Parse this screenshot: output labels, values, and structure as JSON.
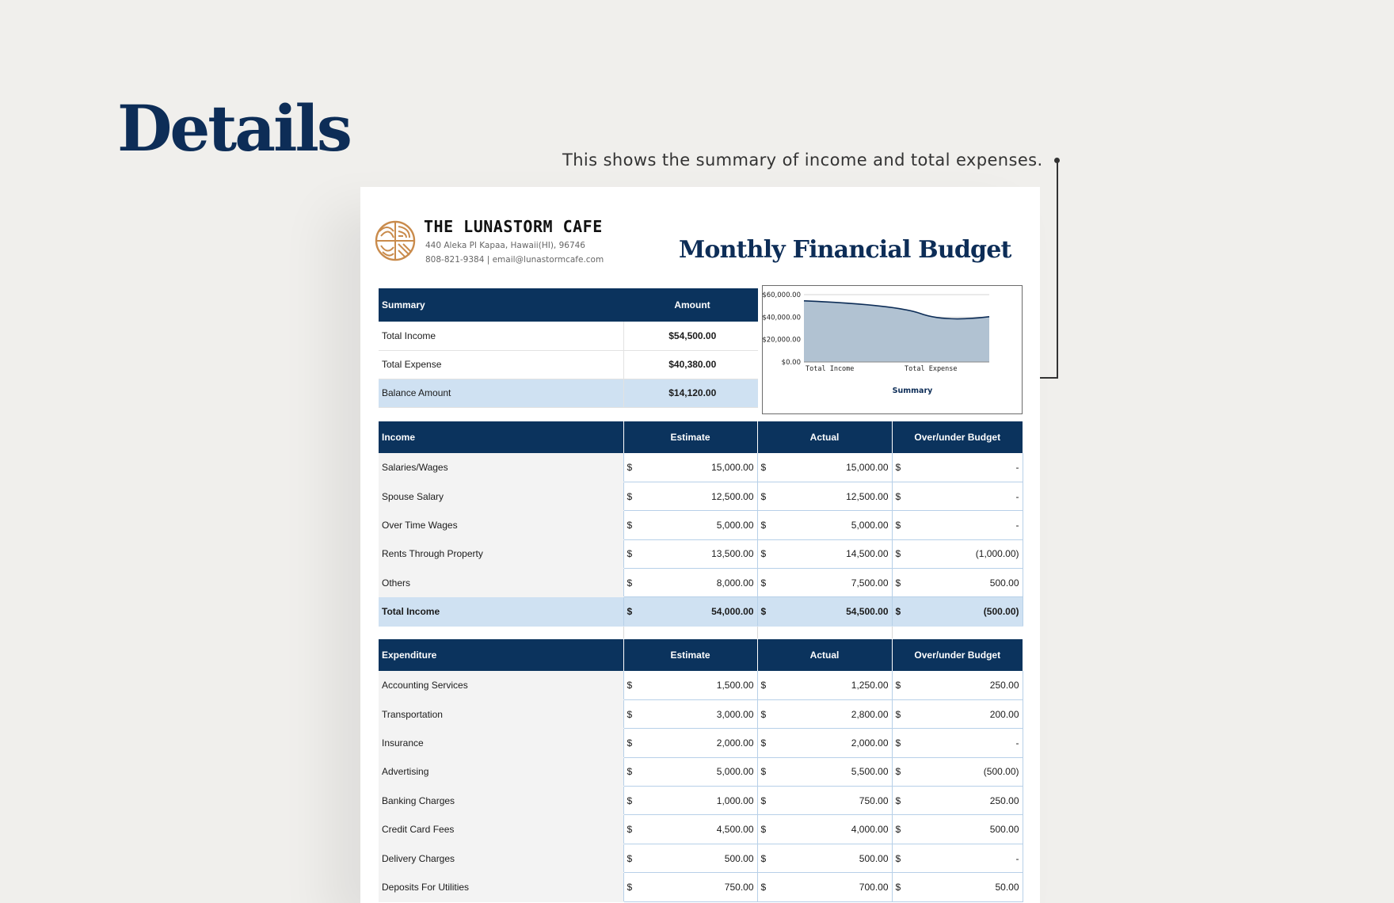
{
  "heading": "Details",
  "callout": "This shows the summary of income and total expenses.",
  "company": {
    "name": "THE LUNASTORM CAFE",
    "address": "440 Aleka Pl Kapaa, Hawaii(HI), 96746",
    "contact": "808-821-9384 | email@lunastormcafe.com"
  },
  "doc_title": "Monthly Financial Budget",
  "summary": {
    "headers": [
      "Summary",
      "Amount"
    ],
    "rows": [
      {
        "label": "Total Income",
        "amount": "$54,500.00"
      },
      {
        "label": "Total Expense",
        "amount": "$40,380.00"
      },
      {
        "label": "Balance Amount",
        "amount": "$14,120.00"
      }
    ]
  },
  "chart_data": {
    "type": "area",
    "categories": [
      "Total Income",
      "Total Expense"
    ],
    "series": [
      {
        "values": [
          54500,
          40380
        ]
      }
    ],
    "xlabel": "Summary",
    "ylabel": "",
    "ylim": [
      0,
      60000
    ],
    "yticks": [
      "$0.00",
      "$20,000.00",
      "$40,000.00",
      "$60,000.00"
    ],
    "grid": true,
    "colors": {
      "fill": "#b1c2d2",
      "line": "#0d2d57"
    }
  },
  "income": {
    "headers": [
      "Income",
      "Estimate",
      "Actual",
      "Over/under Budget"
    ],
    "currency": "$",
    "rows": [
      {
        "label": "Salaries/Wages",
        "estimate": "15,000.00",
        "actual": "15,000.00",
        "over": "-"
      },
      {
        "label": "Spouse Salary",
        "estimate": "12,500.00",
        "actual": "12,500.00",
        "over": "-"
      },
      {
        "label": "Over Time Wages",
        "estimate": "5,000.00",
        "actual": "5,000.00",
        "over": "-"
      },
      {
        "label": "Rents Through Property",
        "estimate": "13,500.00",
        "actual": "14,500.00",
        "over": "(1,000.00)"
      },
      {
        "label": "Others",
        "estimate": "8,000.00",
        "actual": "7,500.00",
        "over": "500.00"
      }
    ],
    "total": {
      "label": "Total Income",
      "estimate": "54,000.00",
      "actual": "54,500.00",
      "over": "(500.00)"
    }
  },
  "expenditure": {
    "headers": [
      "Expenditure",
      "Estimate",
      "Actual",
      "Over/under Budget"
    ],
    "currency": "$",
    "rows": [
      {
        "label": "Accounting Services",
        "estimate": "1,500.00",
        "actual": "1,250.00",
        "over": "250.00"
      },
      {
        "label": "Transportation",
        "estimate": "3,000.00",
        "actual": "2,800.00",
        "over": "200.00"
      },
      {
        "label": "Insurance",
        "estimate": "2,000.00",
        "actual": "2,000.00",
        "over": "-"
      },
      {
        "label": "Advertising",
        "estimate": "5,000.00",
        "actual": "5,500.00",
        "over": "(500.00)"
      },
      {
        "label": "Banking Charges",
        "estimate": "1,000.00",
        "actual": "750.00",
        "over": "250.00"
      },
      {
        "label": "Credit Card Fees",
        "estimate": "4,500.00",
        "actual": "4,000.00",
        "over": "500.00"
      },
      {
        "label": "Delivery Charges",
        "estimate": "500.00",
        "actual": "500.00",
        "over": "-"
      },
      {
        "label": "Deposits For Utilities",
        "estimate": "750.00",
        "actual": "700.00",
        "over": "50.00"
      }
    ]
  }
}
